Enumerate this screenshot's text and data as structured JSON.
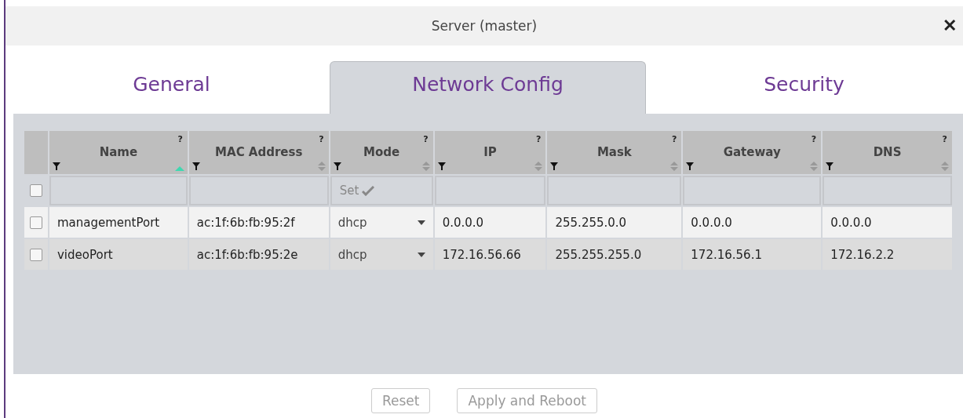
{
  "window": {
    "title": "Server (master)",
    "close": "✕"
  },
  "tabs": [
    {
      "label": "General",
      "selected": false
    },
    {
      "label": "Network Config",
      "selected": true
    },
    {
      "label": "Security",
      "selected": false
    }
  ],
  "table": {
    "select_all": {
      "checked": false
    },
    "columns": [
      {
        "label": "Name",
        "help": "?",
        "sorted": true
      },
      {
        "label": "MAC Address",
        "help": "?",
        "sorted": false
      },
      {
        "label": "Mode",
        "help": "?",
        "sorted": false,
        "filter": "Set"
      },
      {
        "label": "IP",
        "help": "?",
        "sorted": false
      },
      {
        "label": "Mask",
        "help": "?",
        "sorted": false
      },
      {
        "label": "Gateway",
        "help": "?",
        "sorted": false
      },
      {
        "label": "DNS",
        "help": "?",
        "sorted": false
      }
    ],
    "rows": [
      {
        "checked": false,
        "cells": [
          "managementPort",
          "ac:1f:6b:fb:95:2f",
          "dhcp",
          "0.0.0.0",
          "255.255.0.0",
          "0.0.0.0",
          "0.0.0.0"
        ]
      },
      {
        "checked": false,
        "cells": [
          "videoPort",
          "ac:1f:6b:fb:95:2e",
          "dhcp",
          "172.16.56.66",
          "255.255.255.0",
          "172.16.56.1",
          "172.16.2.2"
        ]
      }
    ]
  },
  "buttons": [
    {
      "label": "Reset",
      "disabled": true
    },
    {
      "label": "Apply and Reboot",
      "disabled": true
    }
  ]
}
